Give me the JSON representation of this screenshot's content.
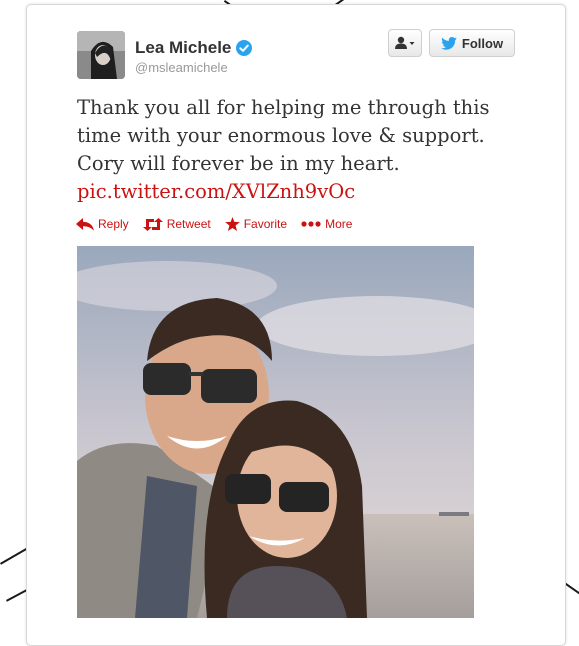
{
  "tweet": {
    "author_name": "Lea Michele",
    "handle": "@msleamichele",
    "text_lines": [
      "Thank you all for helping me through this",
      "time with your enormous love & support.",
      "Cory will forever be in my heart."
    ],
    "link": "pic.twitter.com/XVlZnh9vOc"
  },
  "buttons": {
    "follow_label": "Follow",
    "user_menu_icon": "person-dropdown-icon"
  },
  "actions": {
    "reply": "Reply",
    "retweet": "Retweet",
    "favorite": "Favorite",
    "more": "More"
  },
  "colors": {
    "link": "#cc1111",
    "verified": "#2aa3ef",
    "twitter_bird": "#2aa3ef"
  }
}
